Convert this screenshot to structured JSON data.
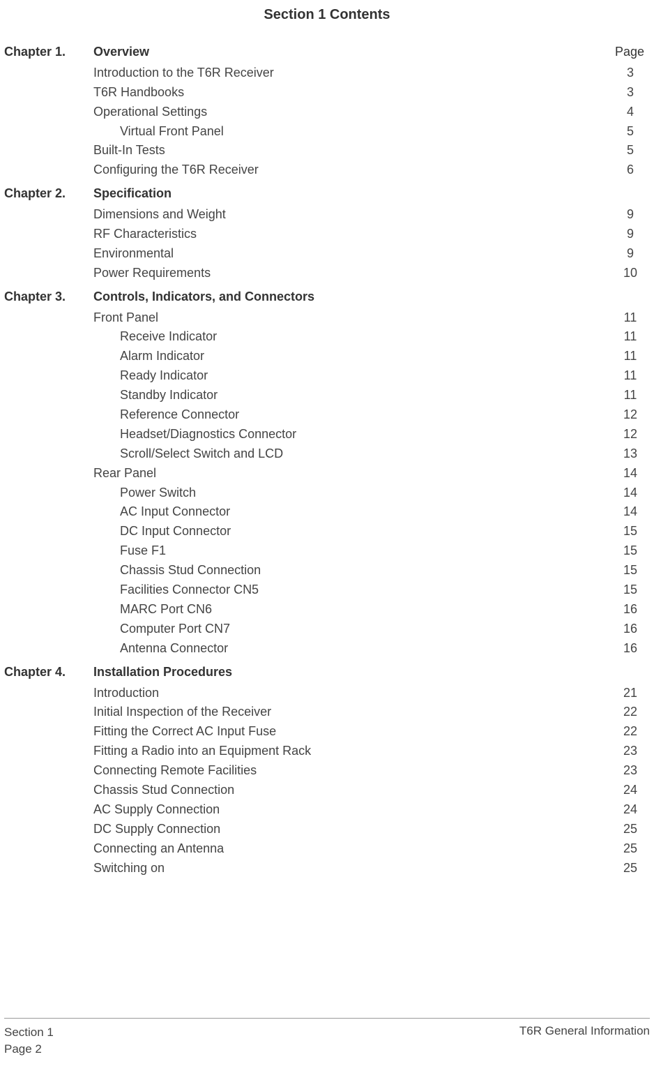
{
  "title": "Section 1 Contents",
  "page_heading": "Page",
  "chapters": [
    {
      "label": "Chapter 1.",
      "title": "Overview",
      "show_page_heading": true,
      "entries": [
        {
          "text": "Introduction to the T6R Receiver",
          "page": "3",
          "indent": 0
        },
        {
          "text": "T6R Handbooks",
          "page": "3",
          "indent": 0
        },
        {
          "text": "Operational Settings",
          "page": "4",
          "indent": 0
        },
        {
          "text": "Virtual Front Panel",
          "page": "5",
          "indent": 1
        },
        {
          "text": "Built-In Tests",
          "page": "5",
          "indent": 0
        },
        {
          "text": "Configuring the T6R Receiver",
          "page": "6",
          "indent": 0
        }
      ]
    },
    {
      "label": "Chapter 2.",
      "title": "Specification",
      "show_page_heading": false,
      "entries": [
        {
          "text": "Dimensions and Weight",
          "page": "9",
          "indent": 0
        },
        {
          "text": "RF Characteristics",
          "page": "9",
          "indent": 0
        },
        {
          "text": "Environmental",
          "page": "9",
          "indent": 0
        },
        {
          "text": "Power Requirements",
          "page": "10",
          "indent": 0
        }
      ]
    },
    {
      "label": "Chapter 3.",
      "title": "Controls, Indicators, and Connectors",
      "show_page_heading": false,
      "entries": [
        {
          "text": "Front Panel",
          "page": "11",
          "indent": 0
        },
        {
          "text": "Receive Indicator",
          "page": "11",
          "indent": 1
        },
        {
          "text": "Alarm Indicator",
          "page": "11",
          "indent": 1
        },
        {
          "text": "Ready Indicator",
          "page": "11",
          "indent": 1
        },
        {
          "text": "Standby Indicator",
          "page": "11",
          "indent": 1
        },
        {
          "text": "Reference Connector",
          "page": "12",
          "indent": 1
        },
        {
          "text": "Headset/Diagnostics Connector",
          "page": "12",
          "indent": 1
        },
        {
          "text": "Scroll/Select Switch and LCD",
          "page": "13",
          "indent": 1
        },
        {
          "text": "Rear Panel",
          "page": "14",
          "indent": 0
        },
        {
          "text": "Power Switch",
          "page": "14",
          "indent": 1
        },
        {
          "text": "AC Input Connector",
          "page": "14",
          "indent": 1
        },
        {
          "text": "DC Input Connector",
          "page": "15",
          "indent": 1
        },
        {
          "text": "Fuse F1",
          "page": "15",
          "indent": 1
        },
        {
          "text": "Chassis Stud Connection",
          "page": "15",
          "indent": 1
        },
        {
          "text": "Facilities Connector CN5",
          "page": "15",
          "indent": 1
        },
        {
          "text": "MARC Port CN6",
          "page": "16",
          "indent": 1
        },
        {
          "text": "Computer Port CN7",
          "page": "16",
          "indent": 1
        },
        {
          "text": "Antenna Connector",
          "page": "16",
          "indent": 1
        }
      ]
    },
    {
      "label": "Chapter 4.",
      "title": "Installation Procedures",
      "show_page_heading": false,
      "entries": [
        {
          "text": "Introduction",
          "page": "21",
          "indent": 0
        },
        {
          "text": "Initial Inspection of the Receiver",
          "page": "22",
          "indent": 0
        },
        {
          "text": "Fitting the Correct AC Input Fuse",
          "page": "22",
          "indent": 0
        },
        {
          "text": "Fitting a Radio into an Equipment Rack",
          "page": "23",
          "indent": 0
        },
        {
          "text": "Connecting Remote Facilities",
          "page": "23",
          "indent": 0
        },
        {
          "text": "Chassis Stud Connection",
          "page": "24",
          "indent": 0
        },
        {
          "text": "AC Supply Connection",
          "page": "24",
          "indent": 0
        },
        {
          "text": "DC Supply Connection",
          "page": "25",
          "indent": 0
        },
        {
          "text": "Connecting an Antenna",
          "page": "25",
          "indent": 0
        },
        {
          "text": "Switching on",
          "page": "25",
          "indent": 0
        }
      ]
    }
  ],
  "footer": {
    "left_line1": "Section 1",
    "left_line2": "Page 2",
    "right": "T6R General Information"
  }
}
